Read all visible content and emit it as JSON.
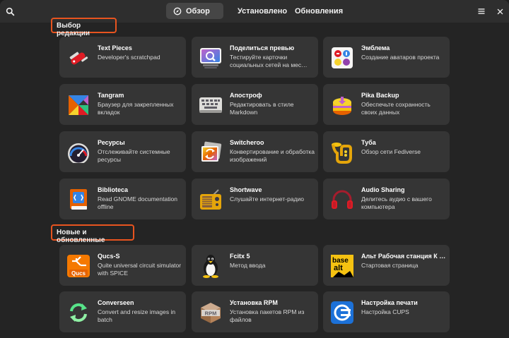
{
  "header": {
    "tabs": [
      {
        "label": "Обзор",
        "icon": "compass-icon",
        "active": true
      },
      {
        "label": "Установлено",
        "icon": "library-icon",
        "active": false
      },
      {
        "label": "Обновления",
        "icon": "refresh-icon",
        "active": false
      }
    ]
  },
  "sections": {
    "editors_choice": "Выбор редакции",
    "new_updated": "Новые и обновленные"
  },
  "apps": [
    {
      "name": "Text Pieces",
      "desc": "Developer's scratchpad",
      "icon": "swiss-knife-icon"
    },
    {
      "name": "Поделиться превью",
      "desc": "Тестируйте карточки социальных сетей на мес…",
      "icon": "share-preview-icon"
    },
    {
      "name": "Эмблема",
      "desc": "Создание аватаров проекта",
      "icon": "emblem-icon"
    },
    {
      "name": "Tangram",
      "desc": "Браузер для закрепленных вкладок",
      "icon": "tangram-icon"
    },
    {
      "name": "Апостроф",
      "desc": "Редактировать в стиле Markdown",
      "icon": "keyboard-icon"
    },
    {
      "name": "Pika Backup",
      "desc": "Обеспечьте сохранность своих данных",
      "icon": "pika-backup-icon"
    },
    {
      "name": "Ресурсы",
      "desc": "Отслеживайте системные ресурсы",
      "icon": "gauge-icon"
    },
    {
      "name": "Switcheroo",
      "desc": "Конвертирование и обработка изображений",
      "icon": "switcheroo-icon"
    },
    {
      "name": "Туба",
      "desc": "Обзор сети Fediverse",
      "icon": "tuba-icon"
    },
    {
      "name": "Biblioteca",
      "desc": "Read GNOME documentation offline",
      "icon": "book-icon"
    },
    {
      "name": "Shortwave",
      "desc": "Слушайте интернет-радио",
      "icon": "radio-icon"
    },
    {
      "name": "Audio Sharing",
      "desc": "Делитесь аудио с вашего компьютера",
      "icon": "headphones-icon"
    },
    {
      "name": "Qucs-S",
      "desc": "Quite universal circuit simulator with SPICE",
      "icon": "qucs-icon"
    },
    {
      "name": "Fcitx 5",
      "desc": "Метод ввода",
      "icon": "tux-icon"
    },
    {
      "name": "Альт Рабочая станция К …",
      "desc": "Стартовая страница",
      "icon": "basealt-icon"
    },
    {
      "name": "Converseen",
      "desc": "Convert and resize images in batch",
      "icon": "converseen-icon"
    },
    {
      "name": "Установка RPM",
      "desc": "Установка пакетов RPM из файлов",
      "icon": "rpm-box-icon"
    },
    {
      "name": "Настройка печати",
      "desc": "Настройка CUPS",
      "icon": "printer-settings-icon"
    }
  ],
  "icon_text": {
    "qucs": "Qucs",
    "rpm": "RPM",
    "base": "base",
    "alt": "alt"
  },
  "colors": {
    "accent_highlight": "#e8541f",
    "card_bg": "#353535",
    "window_bg": "#242424",
    "header_bg": "#2e2e2e"
  }
}
